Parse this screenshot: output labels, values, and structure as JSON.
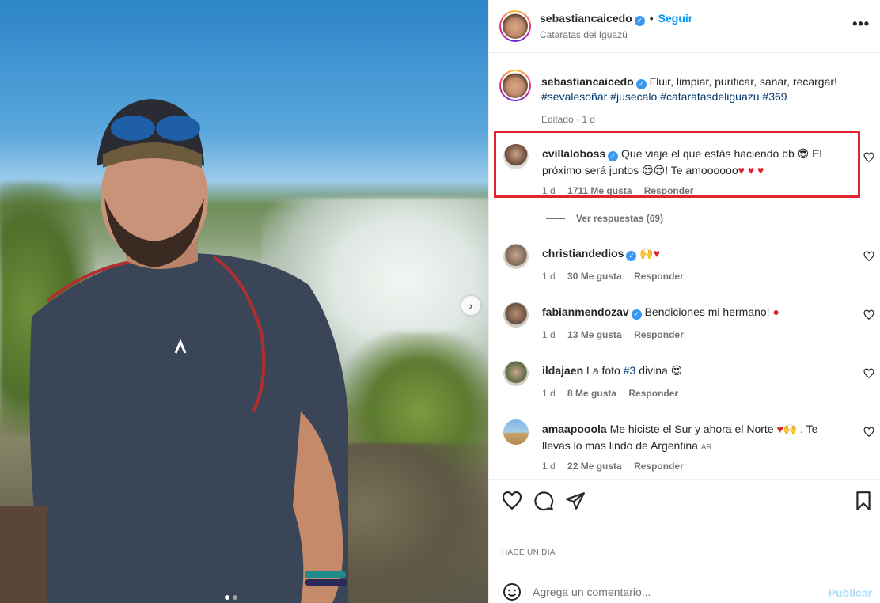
{
  "post": {
    "username": "sebastiancaicedo",
    "follow_label": "Seguir",
    "location": "Cataratas del Iguazú",
    "more_label": "•••",
    "next_arrow": "›",
    "caption_text": "Fluir, limpiar, purificar, sanar, recargar!",
    "caption_tags": [
      "#sevalesoñar",
      "#jusecalo",
      "#cataratasdeliguazu",
      "#369"
    ],
    "caption_meta": "Editado · 1 d"
  },
  "comments": [
    {
      "username": "cvillaloboss",
      "verified": true,
      "text_1": "Que viaje el que estás haciendo bb ",
      "text_2": " El próximo será juntos ",
      "text_3": "! Te amoooooo",
      "time": "1 d",
      "likes": "1711 Me gusta",
      "reply": "Responder",
      "view_replies": "Ver respuestas (69)"
    },
    {
      "username": "christiandedios",
      "verified": true,
      "text_1": "",
      "time": "1 d",
      "likes": "30 Me gusta",
      "reply": "Responder"
    },
    {
      "username": "fabianmendozav",
      "verified": true,
      "text_1": "Bendiciones mi hermano! ",
      "time": "1 d",
      "likes": "13 Me gusta",
      "reply": "Responder"
    },
    {
      "username": "ildajaen",
      "verified": false,
      "text_1": "La foto ",
      "tag": "#3",
      "text_2": " divina ",
      "time": "1 d",
      "likes": "8 Me gusta",
      "reply": "Responder"
    },
    {
      "username": "amaapooola",
      "verified": false,
      "text_1": "Me hiciste el Sur y ahora el Norte ",
      "text_2": " . Te llevas lo más lindo de Argentina ",
      "flag": "AR",
      "time": "1 d",
      "likes": "22 Me gusta",
      "reply": "Responder"
    }
  ],
  "footer": {
    "time_ago": "HACE UN DÍA",
    "comment_placeholder": "Agrega un comentario...",
    "publish_label": "Publicar"
  },
  "icons": {
    "heart": "heart-icon",
    "comment": "comment-icon",
    "share": "share-icon",
    "bookmark": "bookmark-icon",
    "smile": "emoji-icon"
  },
  "colors": {
    "accent": "#0095f6",
    "highlight": "#e0232c",
    "verified": "#3897f0",
    "tag": "#00376b"
  }
}
